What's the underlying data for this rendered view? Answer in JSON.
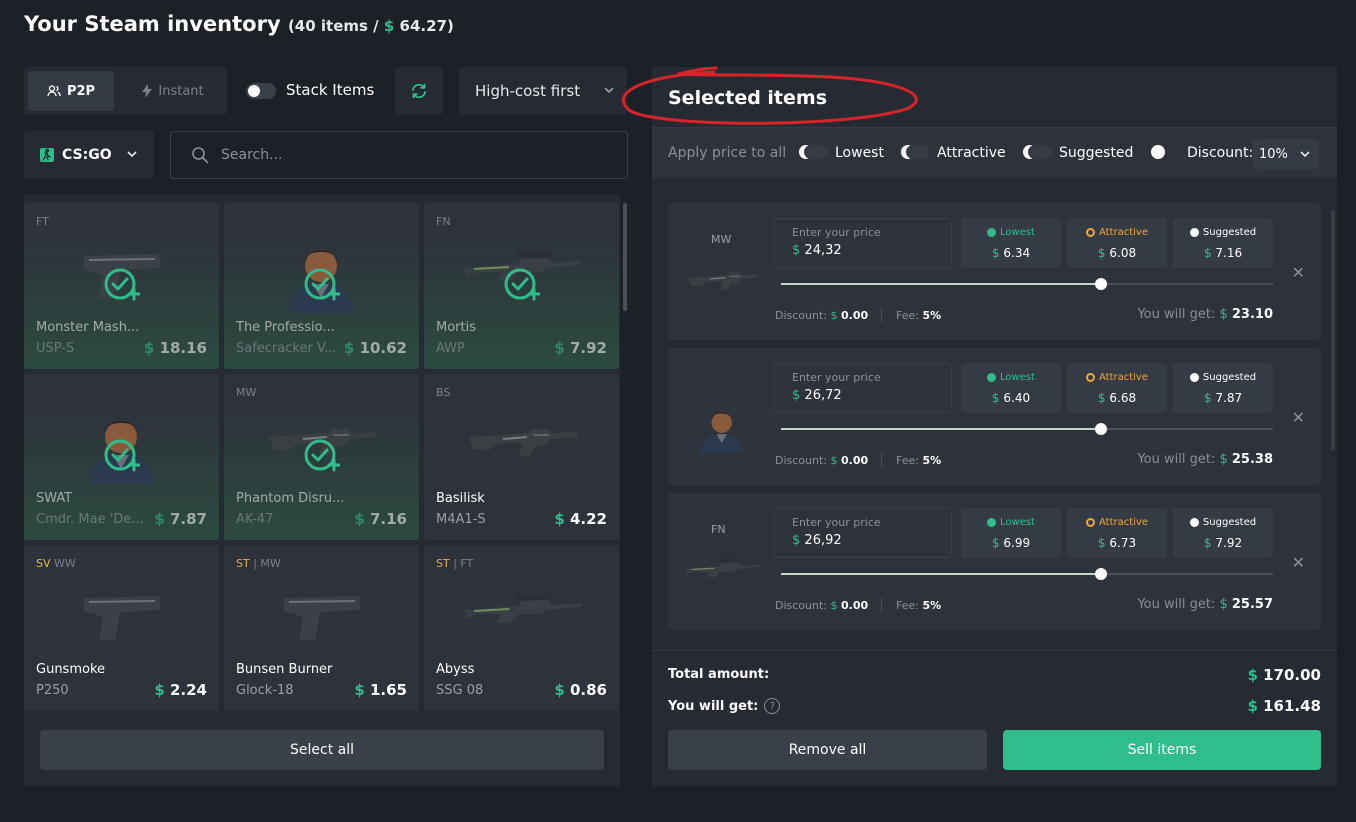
{
  "header": {
    "title": "Your Steam inventory",
    "count": "(40 items / ",
    "currency": "$",
    "total": "64.27",
    "close": ")"
  },
  "toolbar": {
    "p2p_label": "P2P",
    "instant_label": "Instant",
    "stack_label": "Stack Items",
    "stack_on": false,
    "sort_label": "High-cost first",
    "game_label": "CS:GO",
    "search_placeholder": "Search..."
  },
  "inventory": [
    {
      "cond": "FT",
      "tag": "",
      "name": "Monster Mash...",
      "type": "USP-S",
      "price": "18.16",
      "selected": true,
      "icon": "pistol-icon"
    },
    {
      "cond": "",
      "tag": "",
      "name": "The Professio...",
      "type": "Safecracker V...",
      "price": "10.62",
      "selected": true,
      "icon": "agent-icon"
    },
    {
      "cond": "FN",
      "tag": "",
      "name": "Mortis",
      "type": "AWP",
      "price": "7.92",
      "selected": true,
      "icon": "sniper-icon"
    },
    {
      "cond": "",
      "tag": "",
      "name": "SWAT",
      "type": "Cmdr. Mae 'De...",
      "price": "7.87",
      "selected": true,
      "icon": "agent-icon"
    },
    {
      "cond": "MW",
      "tag": "",
      "name": "Phantom Disru...",
      "type": "AK-47",
      "price": "7.16",
      "selected": true,
      "icon": "rifle-icon"
    },
    {
      "cond": "BS",
      "tag": "",
      "name": "Basilisk",
      "type": "M4A1-S",
      "price": "4.22",
      "selected": false,
      "icon": "rifle-icon"
    },
    {
      "cond": "WW",
      "tag": "SV",
      "name": "Gunsmoke",
      "type": "P250",
      "price": "2.24",
      "selected": false,
      "icon": "pistol-icon"
    },
    {
      "cond": "MW",
      "tag": "ST",
      "name": "Bunsen Burner",
      "type": "Glock-18",
      "price": "1.65",
      "selected": false,
      "icon": "pistol-icon"
    },
    {
      "cond": "FT",
      "tag": "ST",
      "name": "Abyss",
      "type": "SSG 08",
      "price": "0.86",
      "selected": false,
      "icon": "sniper-icon"
    }
  ],
  "select_all_label": "Select all",
  "selected": {
    "title": "Selected items",
    "apply_label": "Apply price to all",
    "lowest_label": "Lowest",
    "attractive_label": "Attractive",
    "suggested_label": "Suggested",
    "discount_label": "Discount:",
    "discount_value": "10%",
    "price_placeholder": "Enter your price",
    "discount_text": "Discount:",
    "fee_text": "Fee:",
    "get_text": "You will get:",
    "items": [
      {
        "cond": "MW",
        "price": "24,32",
        "lowest": "6.34",
        "attractive": "6.08",
        "suggested": "7.16",
        "discount": "0.00",
        "fee": "5%",
        "get": "23.10",
        "slider": 0.65,
        "icon": "rifle-icon"
      },
      {
        "cond": "",
        "price": "26,72",
        "lowest": "6.40",
        "attractive": "6.68",
        "suggested": "7.87",
        "discount": "0.00",
        "fee": "5%",
        "get": "25.38",
        "slider": 0.65,
        "icon": "agent-icon"
      },
      {
        "cond": "FN",
        "price": "26,92",
        "lowest": "6.99",
        "attractive": "6.73",
        "suggested": "7.92",
        "discount": "0.00",
        "fee": "5%",
        "get": "25.57",
        "slider": 0.65,
        "icon": "sniper-icon"
      }
    ]
  },
  "summary": {
    "total_label": "Total amount:",
    "total_value": "170.00",
    "get_label": "You will get:",
    "get_value": "161.48",
    "remove_label": "Remove all",
    "sell_label": "Sell items"
  },
  "colors": {
    "accent": "#2fbe8b",
    "attractive": "#f0a734",
    "annotation": "#d8232a"
  }
}
